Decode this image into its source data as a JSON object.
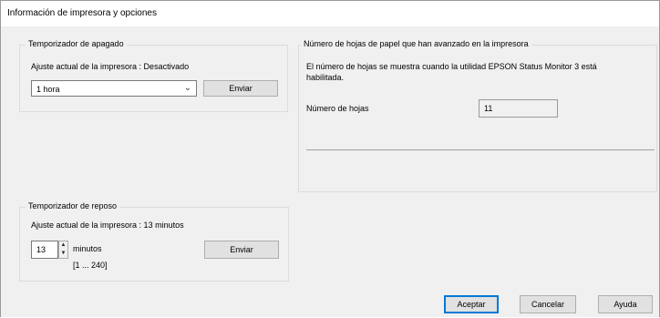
{
  "window": {
    "title": "Información de impresora y opciones"
  },
  "power_off_timer": {
    "legend": "Temporizador de apagado",
    "current_setting": "Ajuste actual de la impresora : Desactivado",
    "selected_option": "1 hora",
    "send_label": "Enviar"
  },
  "sheets_counter": {
    "legend": "Número de hojas de papel que han avanzado en la impresora",
    "description_line1": "El número de hojas se muestra cuando la utilidad EPSON Status Monitor 3 está",
    "description_line2": "habilitada.",
    "count_label": "Número de hojas",
    "count_value": "11"
  },
  "sleep_timer": {
    "legend": "Temporizador de reposo",
    "current_setting": "Ajuste actual de la impresora : 13 minutos",
    "value": "13",
    "unit": "minutos",
    "range": "[1 ... 240]",
    "send_label": "Enviar"
  },
  "footer": {
    "ok_label": "Aceptar",
    "cancel_label": "Cancelar",
    "help_label": "Ayuda"
  }
}
